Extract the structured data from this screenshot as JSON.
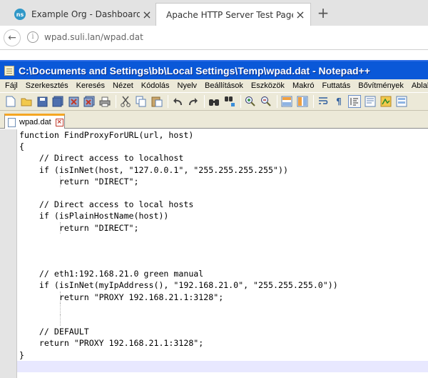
{
  "browser": {
    "tabs": [
      {
        "title": "Example Org - Dashboard",
        "favicon": "ns",
        "active": false
      },
      {
        "title": "Apache HTTP Server Test Page po...",
        "active": true
      }
    ],
    "new_tab_label": "+",
    "close_glyph": "×",
    "url": "wpad.suli.lan/wpad.dat"
  },
  "notepad": {
    "title": "C:\\Documents and Settings\\bb\\Local Settings\\Temp\\wpad.dat - Notepad++",
    "menu": [
      "Fájl",
      "Szerkesztés",
      "Keresés",
      "Nézet",
      "Kódolás",
      "Nyelv",
      "Beállítások",
      "Eszközök",
      "Makró",
      "Futtatás",
      "Bővítmények",
      "Ablak"
    ],
    "document_tab": "wpad.dat",
    "toolbar_icons": [
      "new-file",
      "open-file",
      "save",
      "save-all",
      "close",
      "close-all",
      "print",
      "cut",
      "copy",
      "paste",
      "undo",
      "redo",
      "find",
      "replace",
      "zoom-in",
      "zoom-out",
      "sync-vertical",
      "sync-horizontal",
      "word-wrap",
      "show-all-chars",
      "indent-guide",
      "user-defined-language",
      "doc-map",
      "function-list"
    ],
    "code_lines": [
      "function FindProxyForURL(url, host)",
      "{",
      "    // Direct access to localhost",
      "    if (isInNet(host, \"127.0.0.1\", \"255.255.255.255\"))",
      "        return \"DIRECT\";",
      "",
      "    // Direct access to local hosts",
      "    if (isPlainHostName(host))",
      "        return \"DIRECT\";",
      "",
      "",
      "",
      "    // eth1:192.168.21.0 green manual",
      "    if (isInNet(myIpAddress(), \"192.168.21.0\", \"255.255.255.0\"))",
      "        return \"PROXY 192.168.21.1:3128\";",
      "",
      "",
      "    // DEFAULT",
      "    return \"PROXY 192.168.21.1:3128\";",
      "}",
      ""
    ],
    "colors": {
      "title_bar": "#0a58d8",
      "menu_bg": "#ece9d8",
      "current_line": "#e8e8ff",
      "tab_accent": "#f5a623"
    }
  }
}
